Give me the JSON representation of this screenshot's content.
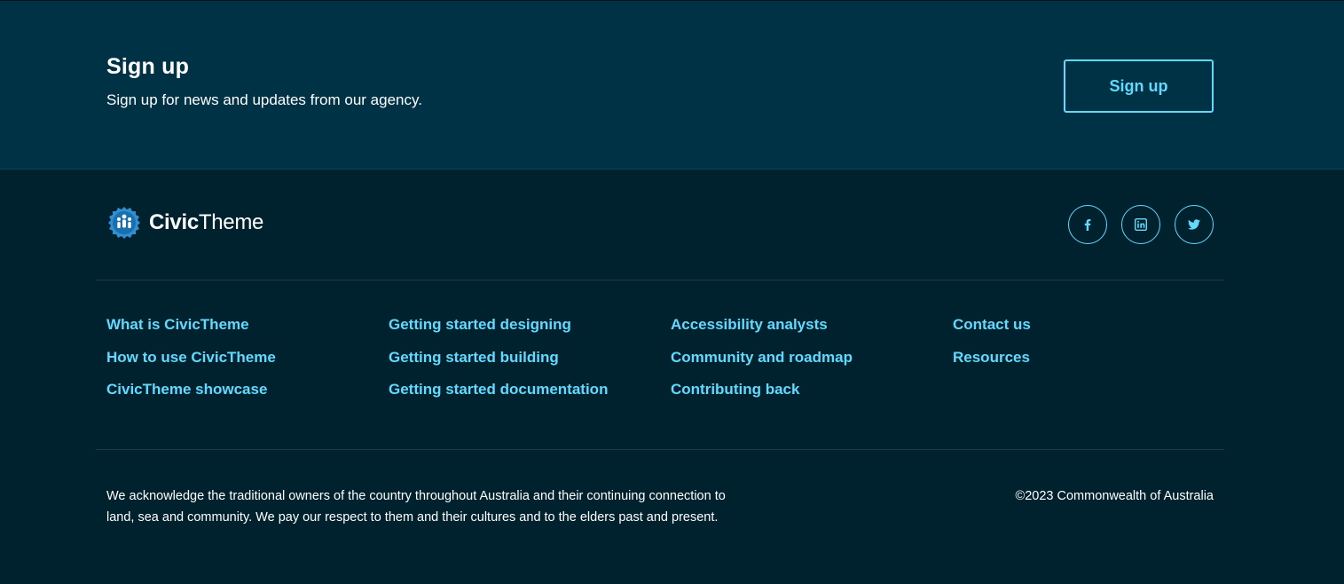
{
  "signup": {
    "title": "Sign up",
    "description": "Sign up for news and updates from our agency.",
    "button_label": "Sign up"
  },
  "footer": {
    "logo": {
      "bold": "Civic",
      "regular": "Theme"
    },
    "social": [
      {
        "name": "facebook",
        "icon": "facebook-icon"
      },
      {
        "name": "linkedin",
        "icon": "linkedin-icon"
      },
      {
        "name": "twitter",
        "icon": "twitter-icon"
      }
    ],
    "links": {
      "col1": [
        "What is CivicTheme",
        "How to use CivicTheme",
        "CivicTheme showcase"
      ],
      "col2": [
        "Getting started designing",
        "Getting started building",
        "Getting started documentation"
      ],
      "col3": [
        "Accessibility analysts",
        "Community and roadmap",
        "Contributing back"
      ],
      "col4": [
        "Contact us",
        "Resources"
      ]
    },
    "acknowledgement": "We acknowledge the traditional owners of the country throughout Australia and their continuing connection to land, sea and community. We pay our respect to them and their cultures and to the elders past and present.",
    "copyright": "©2023 Commonwealth of Australia"
  },
  "colors": {
    "signup_bg": "#003246",
    "footer_bg": "#00222e",
    "accent": "#61daff",
    "text": "#ffffff"
  }
}
